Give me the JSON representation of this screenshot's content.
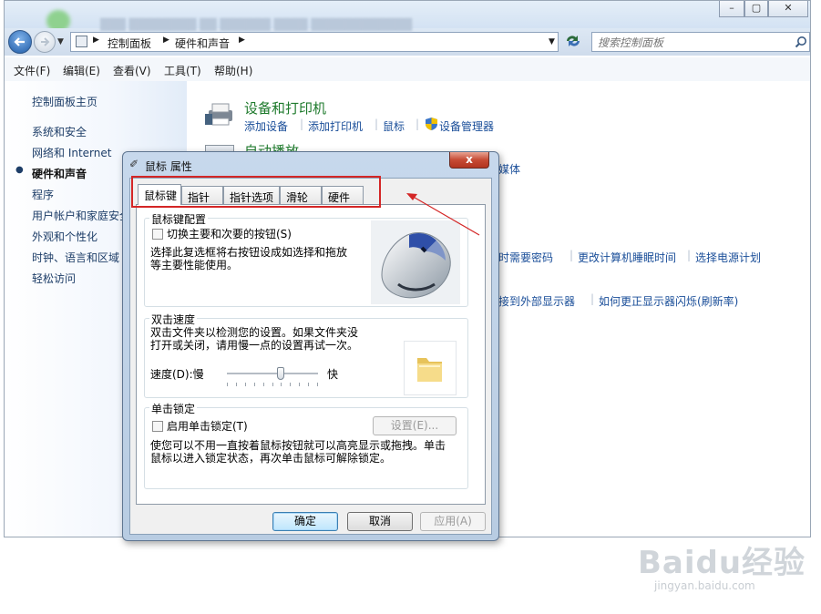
{
  "explorer": {
    "breadcrumb": [
      "控制面板",
      "硬件和声音"
    ],
    "search_placeholder": "搜索控制面板",
    "menu": [
      "文件(F)",
      "编辑(E)",
      "查看(V)",
      "工具(T)",
      "帮助(H)"
    ],
    "sidebar": {
      "home": "控制面板主页",
      "items": [
        "系统和安全",
        "网络和 Internet",
        "硬件和声音",
        "程序",
        "用户帐户和家庭安全",
        "外观和个性化",
        "时钟、语言和区域",
        "轻松访问"
      ],
      "active_index": 2
    },
    "devices": {
      "title": "设备和打印机",
      "links": [
        "添加设备",
        "添加打印机",
        "鼠标",
        "设备管理器"
      ]
    },
    "autoplay": {
      "title": "自动播放",
      "partial_link": "媒体"
    },
    "power_links": [
      "时需要密码",
      "更改计算机睡眠时间",
      "选择电源计划"
    ],
    "display_links": [
      "接到外部显示器",
      "如何更正显示器闪烁(刷新率)"
    ]
  },
  "dialog": {
    "title": "鼠标 属性",
    "close_label": "x",
    "tabs": [
      "鼠标键",
      "指针",
      "指针选项",
      "滑轮",
      "硬件"
    ],
    "active_tab": 0,
    "button_config": {
      "label": "鼠标键配置",
      "checkbox_label": "切换主要和次要的按钮(S)",
      "description_line1": "选择此复选框将右按钮设成如选择和拖放",
      "description_line2": "等主要性能使用。"
    },
    "double_click": {
      "label": "双击速度",
      "description_line1": "双击文件夹以检测您的设置。如果文件夹没",
      "description_line2": "打开或关闭，请用慢一点的设置再试一次。",
      "speed_label": "速度(D):慢",
      "fast_label": "快",
      "slider_value": 0.6
    },
    "click_lock": {
      "label": "单击锁定",
      "checkbox_label": "启用单击锁定(T)",
      "settings_button": "设置(E)...",
      "description_line1": "使您可以不用一直按着鼠标按钮就可以高亮显示或拖拽。单击",
      "description_line2": "鼠标以进入锁定状态，再次单击鼠标可解除锁定。"
    },
    "buttons": {
      "ok": "确定",
      "cancel": "取消",
      "apply": "应用(A)"
    }
  },
  "watermark": {
    "brand": "Baidu经验",
    "url": "jingyan.baidu.com"
  },
  "colors": {
    "annotation": "#d42626",
    "link": "#1a4e99",
    "category": "#1e7a2c"
  }
}
